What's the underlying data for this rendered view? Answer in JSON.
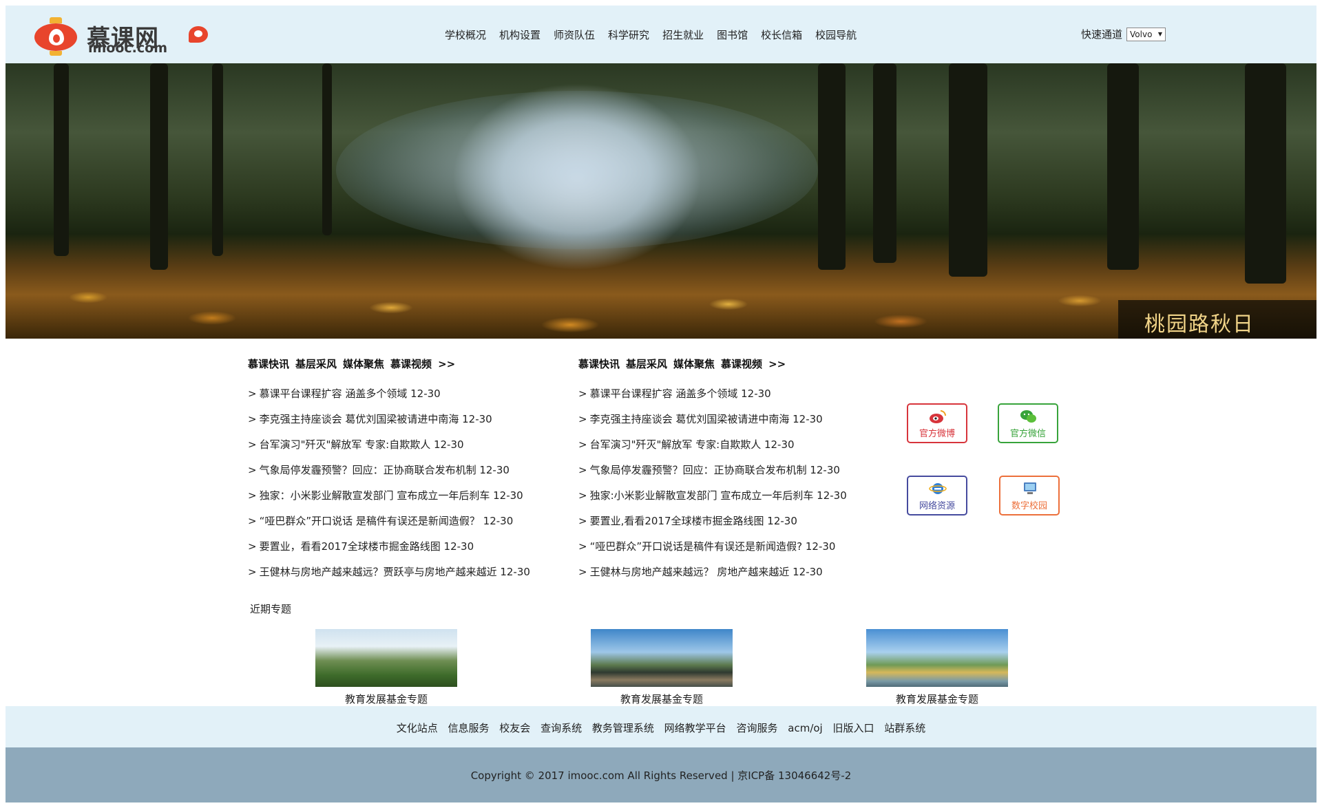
{
  "header": {
    "logo_cn": "慕课网",
    "logo_en": "imooc.com",
    "nav": [
      "学校概况",
      "机构设置",
      "师资队伍",
      "科学研究",
      "招生就业",
      "图书馆",
      "校长信箱",
      "校园导航"
    ],
    "quick_label": "快速通道",
    "quick_select_value": "Volvo"
  },
  "banner": {
    "caption": "桃园路秋日"
  },
  "news": [
    {
      "tabs": [
        "慕课快讯",
        "基层采风",
        "媒体聚焦",
        "慕课视频",
        ">>"
      ],
      "items": [
        "慕课平台课程扩容 涵盖多个领域 12-30",
        "李克强主持座谈会 葛优刘国梁被请进中南海 12-30",
        "台军演习\"歼灭\"解放军 专家:自欺欺人 12-30",
        "气象局停发霾预警？回应：正协商联合发布机制 12-30",
        "独家：小米影业解散宣发部门 宣布成立一年后刹车 12-30",
        "“哑巴群众”开口说话 是稿件有误还是新闻造假？ 12-30",
        "要置业，看看2017全球楼市掘金路线图 12-30",
        "王健林与房地产越来越远？贾跃亭与房地产越来越近 12-30"
      ]
    },
    {
      "tabs": [
        "慕课快讯",
        "基层采风",
        "媒体聚焦",
        "慕课视频",
        ">>"
      ],
      "items": [
        "慕课平台课程扩容 涵盖多个领域 12-30",
        "李克强主持座谈会 葛优刘国梁被请进中南海 12-30",
        "台军演习\"歼灭\"解放军 专家:自欺欺人 12-30",
        "气象局停发霾预警？回应：正协商联合发布机制 12-30",
        "独家:小米影业解散宣发部门 宣布成立一年后刹车 12-30",
        "要置业,看看2017全球楼市掘金路线图 12-30",
        "“哑巴群众”开口说话是稿件有误还是新闻造假? 12-30",
        "王健林与房地产越来越远？ 房地产越来越近 12-30"
      ]
    }
  ],
  "social": {
    "weibo": "官方微博",
    "wechat": "官方微信",
    "net": "网络资源",
    "digital": "数字校园"
  },
  "topics": {
    "title": "近期专题",
    "items": [
      "教育发展基金专题",
      "教育发展基金专题",
      "教育发展基金专题"
    ]
  },
  "footer": {
    "links": [
      "文化站点",
      "信息服务",
      "校友会",
      "查询系统",
      "教务管理系统",
      "网络教学平台",
      "咨询服务",
      "acm/oj",
      "旧版入口",
      "站群系统"
    ],
    "copyright": "Copyright © 2017 imooc.com All Rights Reserved | 京ICP备 13046642号-2"
  },
  "colors": {
    "header_bg": "#e2f1f8",
    "footer_bg": "#8ea9bb",
    "weibo": "#d7343b",
    "wechat": "#37a33a",
    "net": "#454a9e",
    "digital": "#ec6f3a"
  },
  "icons": [
    "logo-lantern-icon",
    "weibo-icon",
    "wechat-icon",
    "ie-icon",
    "computer-icon",
    "select-arrow-icon"
  ]
}
